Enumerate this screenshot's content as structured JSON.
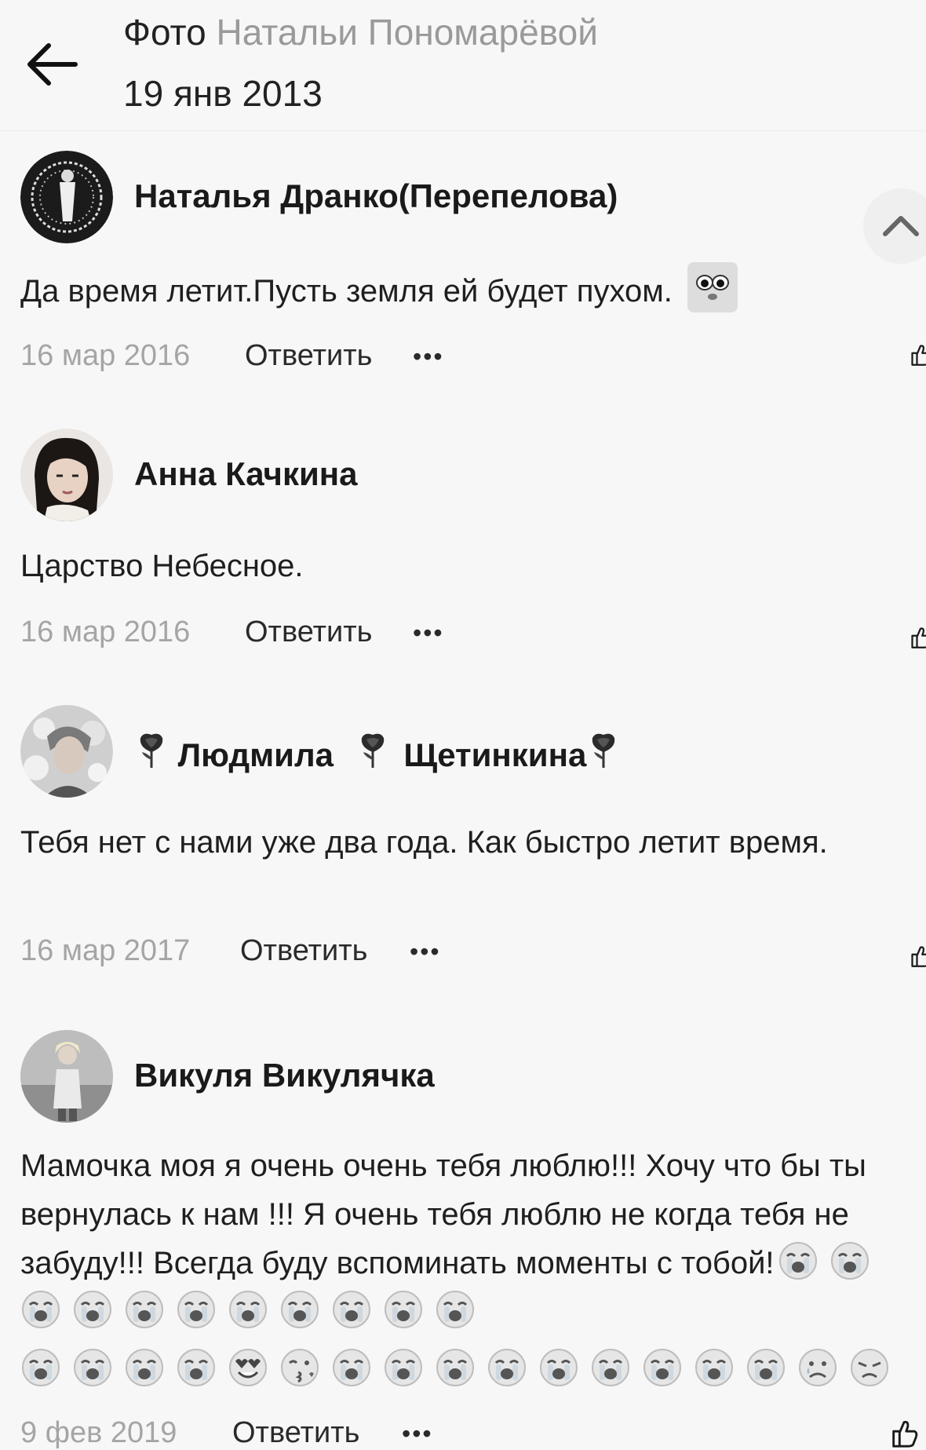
{
  "header": {
    "title_prefix": "Фото",
    "title_owner": "Натальи Пономарёвой",
    "date": "19 янв 2013"
  },
  "icons": {
    "back": "arrow-left-icon",
    "scroll_up": "chevron-up-icon",
    "like": "thumbs-up-icon",
    "more": "more-dots-icon",
    "rose": "black-rose-emoji"
  },
  "colors": {
    "background": "#f7f7f7",
    "muted": "#a5a5a5",
    "title_muted": "#9a9a9a"
  },
  "comments": [
    {
      "author": "Наталья Дранко(Перепелова)",
      "text": "Да время летит.Пусть земля ей будет пухом.",
      "date": "16 мар 2016",
      "reply": "Ответить",
      "more": "•••"
    },
    {
      "author": "Анна Качкина",
      "text": "Царство Небесное.",
      "date": "16 мар 2016",
      "reply": "Ответить",
      "more": "•••"
    },
    {
      "author_part1": "Людмила",
      "author_part2": "Щетинкина",
      "text": "Тебя нет с нами уже два года. Как быстро летит время.",
      "date": "16 мар 2017",
      "reply": "Ответить",
      "more": "•••"
    },
    {
      "author": "Викуля Викулячка",
      "text": "Мамочка моя я очень очень тебя люблю!!! Хочу что бы ты вернулась к нам !!! Я очень тебя люблю не когда тебя не забуду!!! Всегда буду вспоминать моменты с тобой!",
      "date": "9 фев 2019",
      "reply": "Ответить",
      "more": "•••"
    }
  ]
}
